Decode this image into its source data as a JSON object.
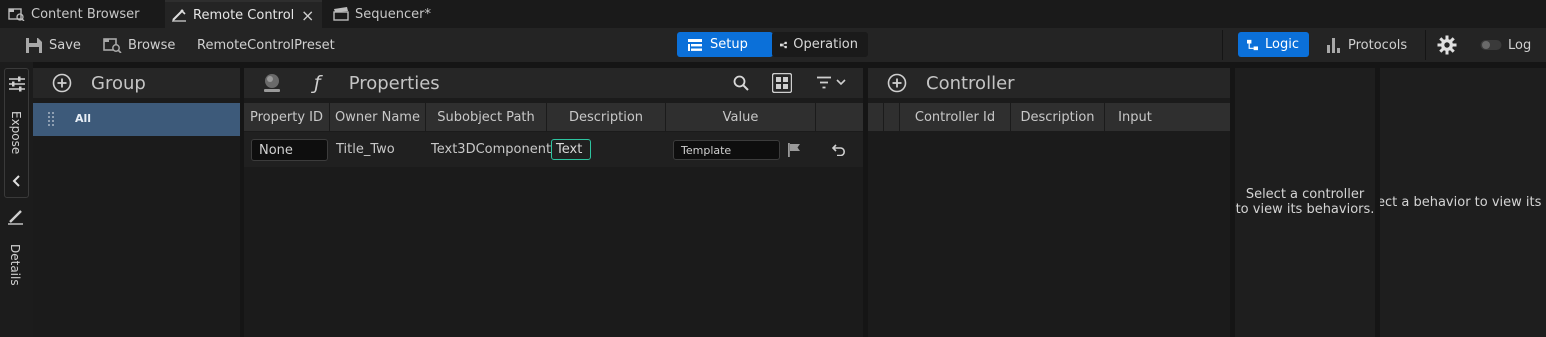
{
  "tabs": [
    {
      "label": "Content Browser",
      "icon": "content-browser-icon",
      "active": false
    },
    {
      "label": "Remote Control",
      "icon": "remote-control-icon",
      "active": true,
      "close": "×"
    },
    {
      "label": "Sequencer*",
      "icon": "clapperboard-icon",
      "active": false
    }
  ],
  "toolbar": {
    "save_label": "Save",
    "browse_label": "Browse",
    "preset_name": "RemoteControlPreset",
    "setup_label": "Setup",
    "operation_label": "Operation",
    "logic_label": "Logic",
    "protocols_label": "Protocols",
    "log_label": "Log"
  },
  "side": {
    "expose_label": "Expose",
    "details_label": "Details"
  },
  "group_panel": {
    "title": "Group",
    "items": [
      {
        "label": "All",
        "selected": true
      }
    ]
  },
  "properties_panel": {
    "title": "Properties",
    "function_glyph": "ƒ",
    "columns": [
      "Property ID",
      "Owner Name",
      "Subobject Path",
      "Description",
      "Value"
    ],
    "rows": [
      {
        "property_id": "None",
        "owner_name": "Title_Two",
        "subobject_path": "Text3DComponent",
        "description": "Text",
        "value": "Template"
      }
    ]
  },
  "controller_panel": {
    "title": "Controller",
    "columns": [
      "Controller Id",
      "Description",
      "Input"
    ]
  },
  "behavior_panel": {
    "message": "Select a controller to view its behaviors.",
    "message_line1": "Select a controller",
    "message_line2": "to view its behaviors."
  },
  "action_panel": {
    "message": "ect a behavior to view its acti"
  },
  "colors": {
    "accent": "#0b70d9",
    "highlight_row": "#3d5a7a",
    "text_badge_border": "#2ec4a0"
  }
}
